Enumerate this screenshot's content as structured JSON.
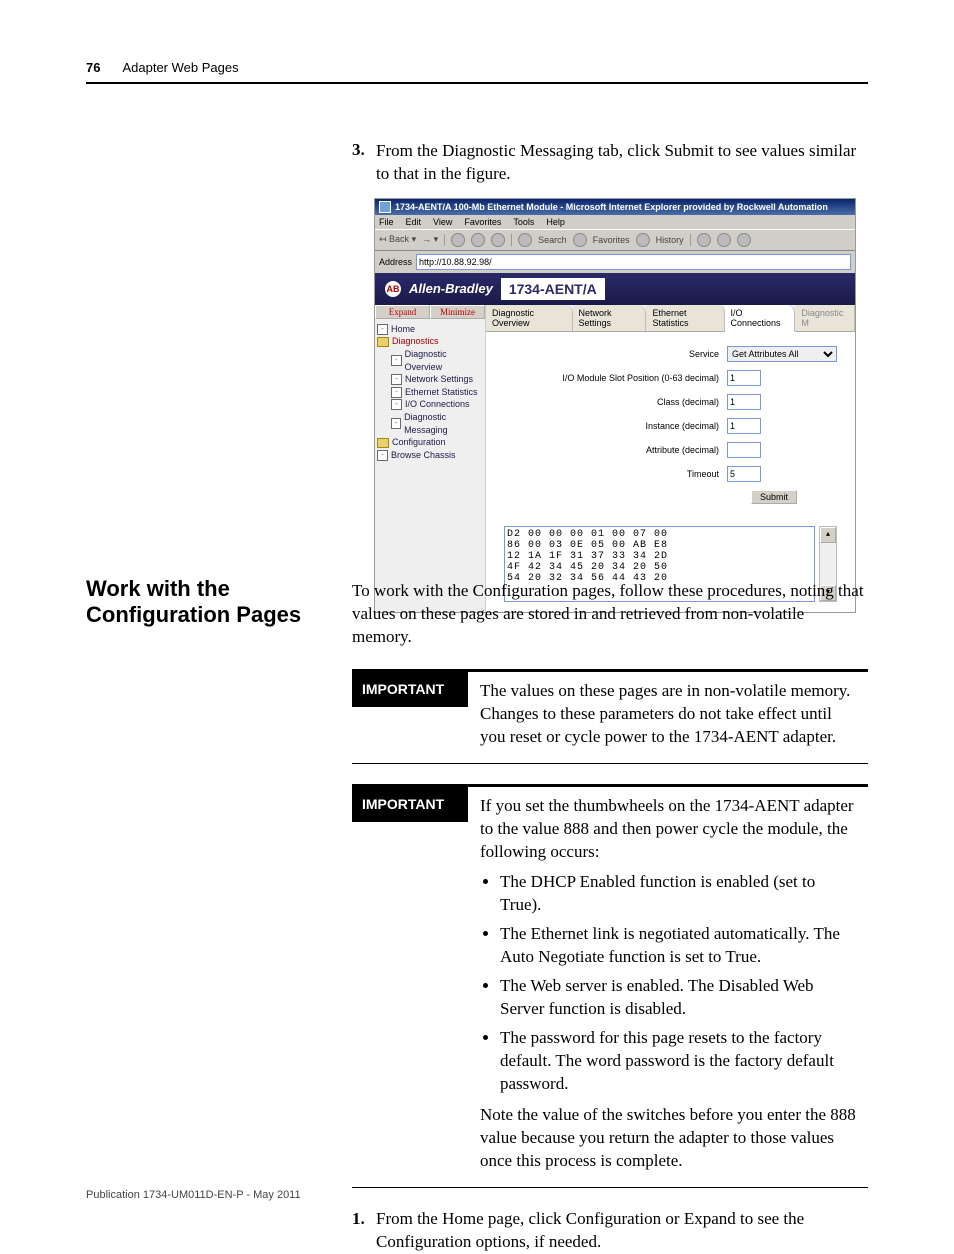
{
  "header": {
    "page_number": "76",
    "chapter": "Adapter Web Pages"
  },
  "step3": {
    "num": "3.",
    "text": "From the Diagnostic Messaging tab, click Submit to see values similar to that in the figure."
  },
  "ie": {
    "title": "1734-AENT/A 100-Mb Ethernet Module - Microsoft Internet Explorer provided by Rockwell Automation",
    "menu": {
      "file": "File",
      "edit": "Edit",
      "view": "View",
      "fav": "Favorites",
      "tools": "Tools",
      "help": "Help"
    },
    "toolbar": {
      "back": "Back",
      "search": "Search",
      "favorites": "Favorites",
      "history": "History"
    },
    "address_label": "Address",
    "address_value": "http://10.88.92.98/",
    "brand": "Allen-Bradley",
    "product": "1734-AENT/A",
    "nav_expand": "Expand",
    "nav_minimize": "Minimize",
    "tree": {
      "home": "Home",
      "diagnostics": "Diagnostics",
      "diag_overview": "Diagnostic Overview",
      "net_set": "Network Settings",
      "eth_stat": "Ethernet Statistics",
      "io_conn": "I/O Connections",
      "diag_msg": "Diagnostic Messaging",
      "config": "Configuration",
      "browse": "Browse Chassis"
    },
    "tabs": {
      "overview": "Diagnostic Overview",
      "network": "Network Settings",
      "ethstat": "Ethernet Statistics",
      "ioconn": "I/O Connections",
      "diagm": "Diagnostic M"
    },
    "form": {
      "service_label": "Service",
      "service_value": "Get Attributes All",
      "slot_label": "I/O Module Slot Position (0-63 decimal)",
      "slot_value": "1",
      "class_label": "Class (decimal)",
      "class_value": "1",
      "instance_label": "Instance (decimal)",
      "instance_value": "1",
      "attribute_label": "Attribute (decimal)",
      "attribute_value": "",
      "timeout_label": "Timeout",
      "timeout_value": "5",
      "submit": "Submit"
    },
    "hex": "D2 00 00 00 01 00 07 00\n86 00 03 0E 05 00 AB E8\n12 1A 1F 31 37 33 34 2D\n4F 42 34 45 20 34 20 50\n54 20 32 34 56 44 43 20"
  },
  "section": {
    "title": "Work with the Configuration Pages",
    "intro": "To work with the Configuration pages, follow these procedures, noting that values on these pages are stored in and retrieved from non-volatile memory."
  },
  "callout1": {
    "label": "IMPORTANT",
    "text": "The values on these pages are in non-volatile memory. Changes to these parameters do not take effect until you reset or cycle power to the 1734-AENT adapter."
  },
  "callout2": {
    "label": "IMPORTANT",
    "intro": "If you set the thumbwheels on the 1734-AENT adapter to the value 888 and then power cycle the module, the following occurs:",
    "b1": "The DHCP Enabled function is enabled (set to True).",
    "b2": "The Ethernet link is negotiated automatically. The Auto Negotiate function is set to True.",
    "b3": "The Web server is enabled. The Disabled Web Server function is disabled.",
    "b4": "The password for this page resets to the factory default. The word password is the factory default password.",
    "note": "Note the value of the switches before you enter the 888 value because you return the adapter to those values once this process is complete."
  },
  "step1": {
    "num": "1.",
    "text": "From the Home page, click Configuration or Expand to see the Configuration options, if needed."
  },
  "footer": "Publication 1734-UM011D-EN-P - May 2011"
}
